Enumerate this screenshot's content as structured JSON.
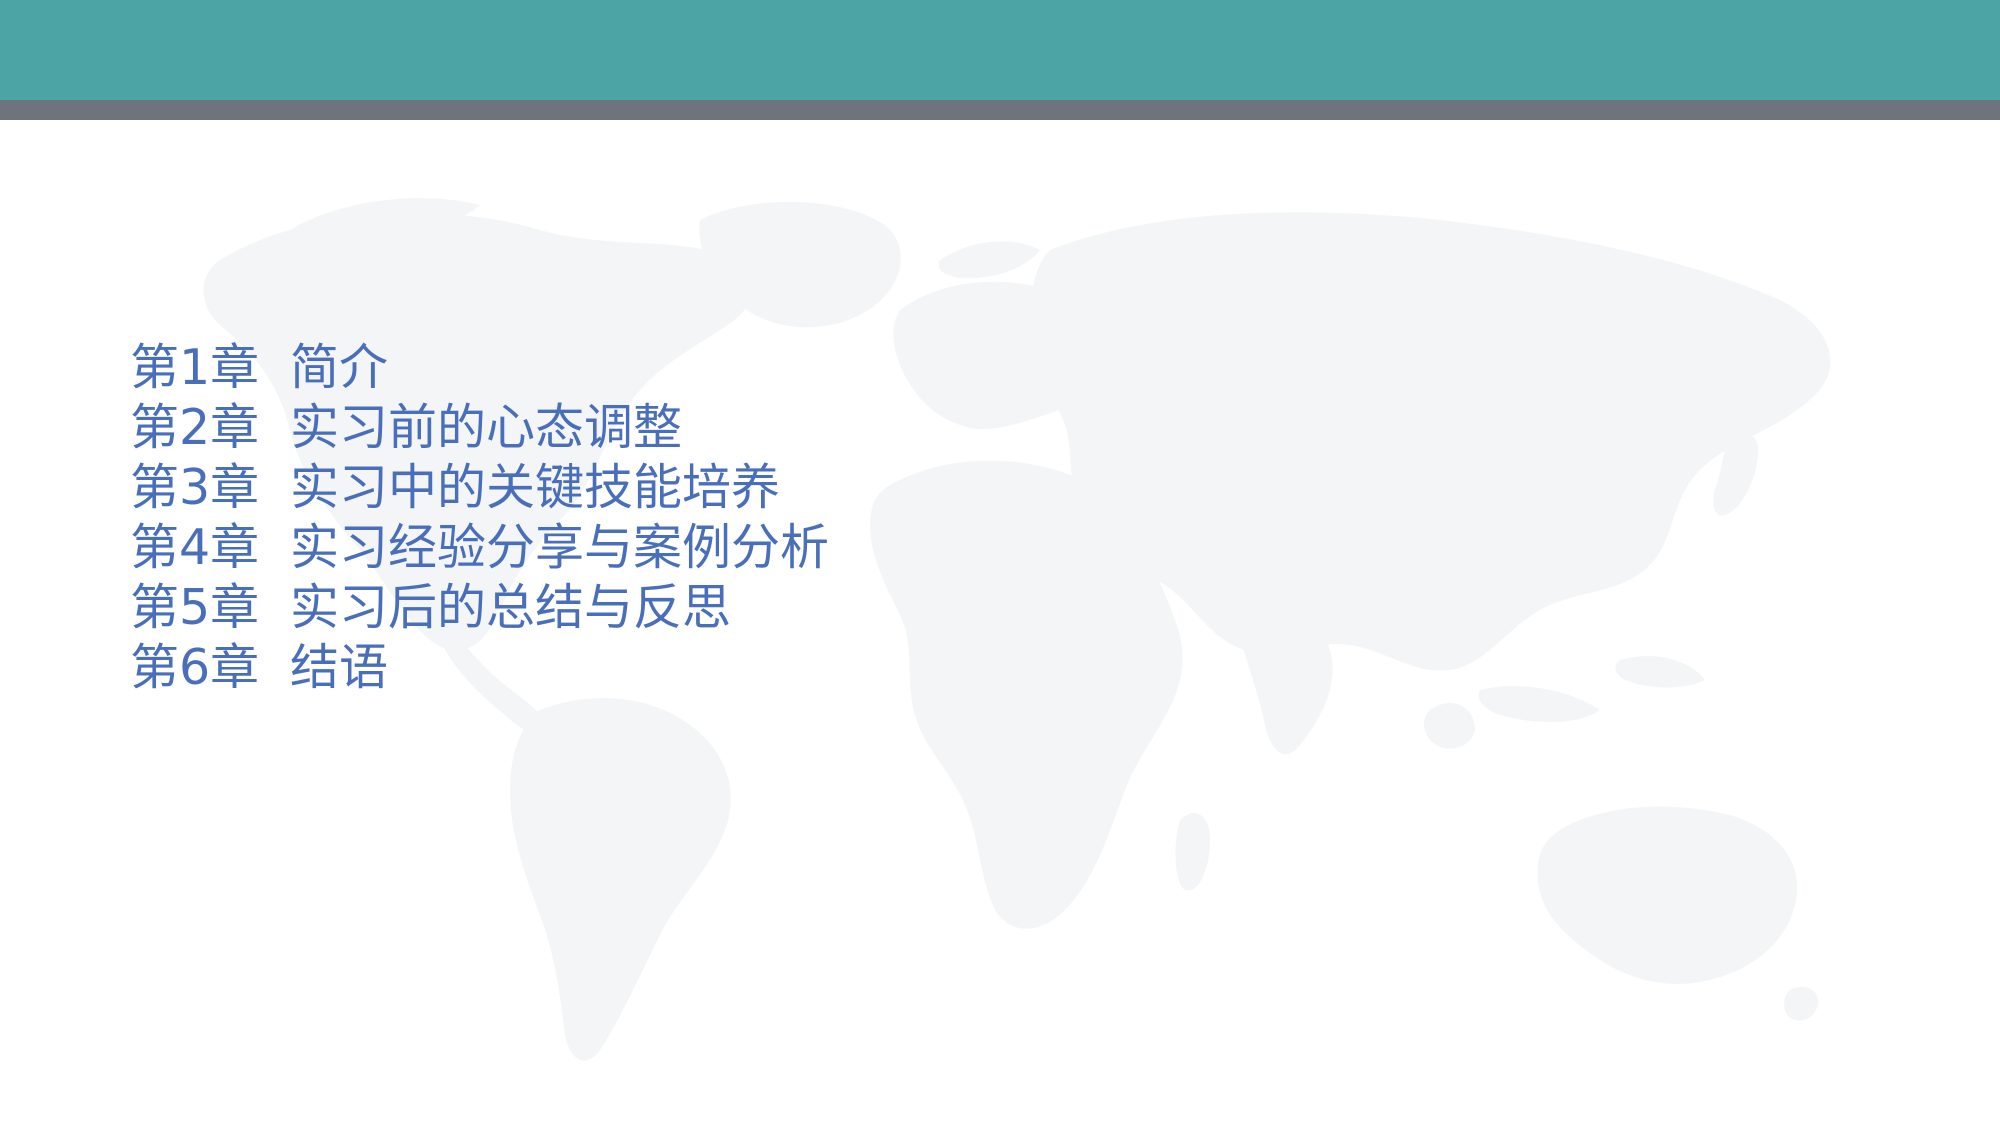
{
  "colors": {
    "header_band": "#4ca5a4",
    "header_stripe": "#6f737b",
    "text": "#4a6fba",
    "map": "#f4f5f6"
  },
  "background_icon": "world-map-icon",
  "toc": [
    {
      "chapter": "第1章",
      "title": "简介"
    },
    {
      "chapter": "第2章",
      "title": "实习前的心态调整"
    },
    {
      "chapter": "第3章",
      "title": "实习中的关键技能培养"
    },
    {
      "chapter": "第4章",
      "title": "实习经验分享与案例分析"
    },
    {
      "chapter": "第5章",
      "title": "实习后的总结与反思"
    },
    {
      "chapter": "第6章",
      "title": "结语"
    }
  ]
}
